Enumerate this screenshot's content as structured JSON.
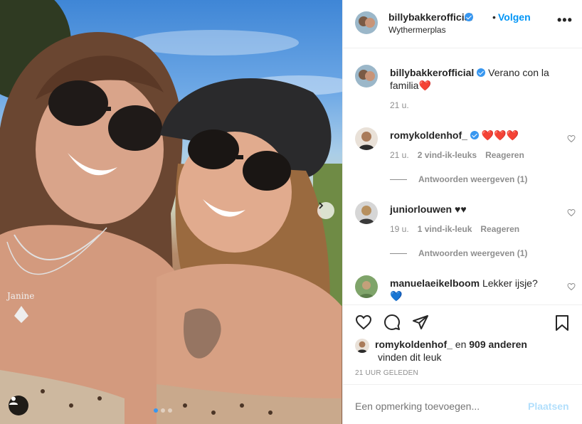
{
  "post_header": {
    "username": "billybakkerofficial",
    "separator": "•",
    "follow_label": "Volgen",
    "location": "Wythermerplas",
    "more_label": "•••"
  },
  "caption": {
    "username": "billybakkerofficial",
    "text": "Verano con la familia",
    "emoji": "❤️",
    "time": "21 u."
  },
  "comments": [
    {
      "username": "romykoldenhof_",
      "text": "❤️❤️❤️",
      "time": "21 u.",
      "likes": "2 vind-ik-leuks",
      "reply_label": "Reageren",
      "view_replies": "Antwoorden weergeven (1)"
    },
    {
      "username": "juniorlouwen",
      "text": "♥♥",
      "time": "19 u.",
      "likes": "1 vind-ik-leuk",
      "reply_label": "Reageren",
      "view_replies": "Antwoorden weergeven (1)"
    },
    {
      "username": "manuelaeikelboom",
      "text": "Lekker ijsje?",
      "emoji": "💙"
    }
  ],
  "likes": {
    "username": "romykoldenhof_",
    "and_label": "en",
    "others": "909 anderen",
    "suffix": "vinden dit leuk"
  },
  "timestamp": "21 UUR GELEDEN",
  "composer": {
    "placeholder": "Een opmerking toevoegen...",
    "post_label": "Plaatsen"
  },
  "icons": {
    "like": "heart-outline-icon",
    "comment": "comment-bubble-icon",
    "share": "paper-plane-icon",
    "save": "bookmark-icon",
    "next": "chevron-right-icon",
    "tagged_users": "user-tag-icon"
  },
  "colors": {
    "accent": "#0095f6",
    "verified": "#3897f0",
    "heart_red": "#ed4956",
    "muted": "#8e8e8e",
    "post_disabled": "#b2dffc"
  }
}
